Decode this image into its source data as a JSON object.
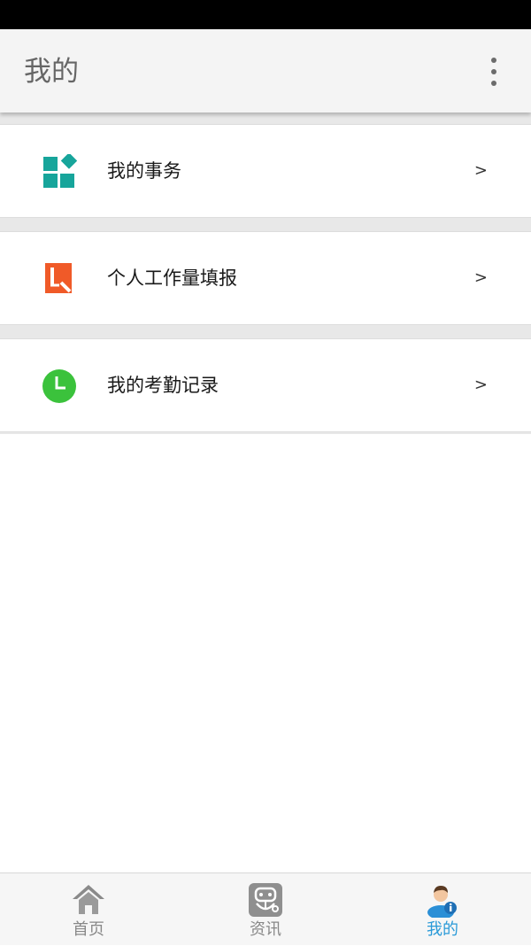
{
  "header": {
    "title": "我的"
  },
  "menu": [
    {
      "label": "我的事务",
      "arrow": ">",
      "icon": "grid-apps-icon",
      "icon_color": "#17a59b"
    },
    {
      "label": "个人工作量填报",
      "arrow": ">",
      "icon": "edit-report-icon",
      "icon_color": "#f05a28"
    },
    {
      "label": "我的考勤记录",
      "arrow": ">",
      "icon": "clock-icon",
      "icon_color": "#3bc23c"
    }
  ],
  "tabs": [
    {
      "label": "首页",
      "icon": "home-icon",
      "active": false
    },
    {
      "label": "资讯",
      "icon": "news-robot-icon",
      "active": false
    },
    {
      "label": "我的",
      "icon": "user-profile-icon",
      "active": true
    }
  ],
  "colors": {
    "active_tab": "#2a9ad8",
    "inactive_tab": "#888888"
  }
}
